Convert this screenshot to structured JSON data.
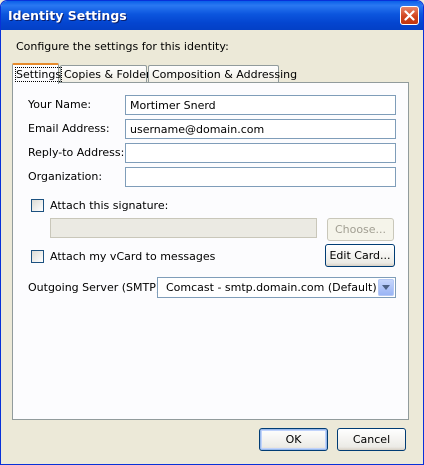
{
  "window": {
    "title": "Identity Settings"
  },
  "caption": "Configure the settings for this identity:",
  "tabs": [
    {
      "label": "Settings",
      "active": true
    },
    {
      "label": "Copies & Folders",
      "active": false
    },
    {
      "label": "Composition & Addressing",
      "active": false
    }
  ],
  "form": {
    "your_name_label": "Your Name:",
    "your_name_value": "Mortimer Snerd",
    "email_label": "Email Address:",
    "email_value": "username@domain.com",
    "reply_to_label": "Reply-to Address:",
    "reply_to_value": "",
    "organization_label": "Organization:",
    "organization_value": "",
    "attach_signature_label": "Attach this signature:",
    "attach_signature_checked": false,
    "signature_path_value": "",
    "choose_label": "Choose...",
    "attach_vcard_label": "Attach my vCard to messages",
    "attach_vcard_checked": false,
    "edit_card_label": "Edit Card...",
    "outgoing_server_label": "Outgoing Server (SMTP):",
    "outgoing_server_value": "Comcast - smtp.domain.com (Default)"
  },
  "buttons": {
    "ok": "OK",
    "cancel": "Cancel"
  },
  "colors": {
    "titlebar": "#0054e3",
    "close": "#d1451f",
    "dialog_bg": "#ece9d8",
    "tab_highlight": "#e68b2c"
  }
}
